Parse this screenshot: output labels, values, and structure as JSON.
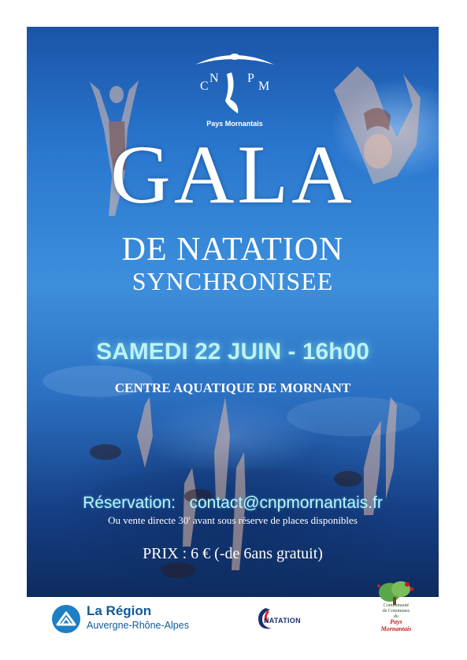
{
  "logo": {
    "letters": [
      "C",
      "N",
      "P",
      "M"
    ],
    "caption": "Pays Mornantais"
  },
  "title": {
    "main": "GALA",
    "line2": "DE  NATATION",
    "line3": "SYNCHRONISEE"
  },
  "event": {
    "date": "SAMEDI 22 JUIN - 16h00",
    "venue": "CENTRE AQUATIQUE DE MORNANT"
  },
  "reservation": {
    "label": "Réservation:   contact@cnpmornantais.fr",
    "note": "Ou vente directe 30' avant sous réserve de places disponibles"
  },
  "price": "PRIX : 6 € (-de 6ans gratuit)",
  "sponsors": {
    "region_name": "La Région",
    "region_sub": "Auvergne-Rhône-Alpes",
    "ffn": "NATATION",
    "ccpm_line1": "Communauté",
    "ccpm_line2": "de Communes",
    "ccpm_line3": "du",
    "ccpm_line4": "Pays",
    "ccpm_line5": "Mornantais"
  },
  "colors": {
    "pool_blue": "#2a78cf",
    "date_glow": "#bdf2f5",
    "region_blue": "#0d5a9b",
    "ccpm_red": "#c22020"
  }
}
